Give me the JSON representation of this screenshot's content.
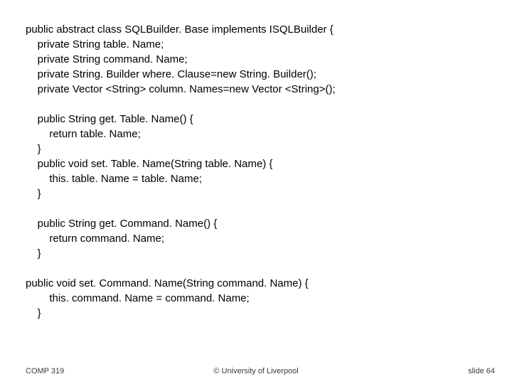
{
  "code": {
    "line1": "public abstract class SQLBuilder. Base implements ISQLBuilder {",
    "line2": "    private String table. Name;",
    "line3": "    private String command. Name;",
    "line4": "    private String. Builder where. Clause=new String. Builder();",
    "line5": "    private Vector <String> column. Names=new Vector <String>();",
    "blank1": "",
    "line6": "    public String get. Table. Name() {",
    "line7": "        return table. Name;",
    "line8": "    }",
    "line9": "    public void set. Table. Name(String table. Name) {",
    "line10": "        this. table. Name = table. Name;",
    "line11": "    }",
    "blank2": "",
    "line12": "    public String get. Command. Name() {",
    "line13": "        return command. Name;",
    "line14": "    }",
    "blank3": "",
    "line15": "public void set. Command. Name(String command. Name) {",
    "line16": "        this. command. Name = command. Name;",
    "line17": "    }"
  },
  "footer": {
    "left": "COMP 319",
    "center": "© University of Liverpool",
    "right": "slide  64"
  }
}
